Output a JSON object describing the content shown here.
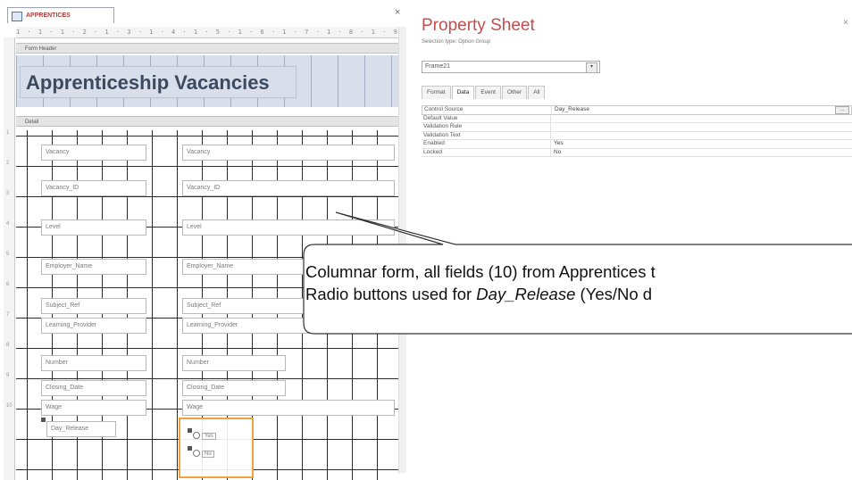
{
  "document_tab": {
    "label": "APPRENTICES"
  },
  "ruler": {
    "ticks": "1 · 1 · 1 · 2 · 1 · 3 · 1 · 4 · 1 · 5 · 1 · 6 · 1 · 7 · 1 · 8 · 1 · 9 · 1 · 10 · 1"
  },
  "sections": {
    "form_header": "Form Header",
    "detail": "Detail"
  },
  "form": {
    "title": "Apprenticeship Vacancies",
    "labels": [
      "Vacancy",
      "Vacancy_ID",
      "Level",
      "Employer_Name",
      "Subject_Ref",
      "Learning_Provider",
      "Number",
      "Closing_Date",
      "Wage",
      "Day_Release"
    ],
    "boxes": [
      "Vacancy",
      "Vacancy_ID",
      "Level",
      "Employer_Name",
      "Subject_Ref",
      "Learning_Provider",
      "Number",
      "Closing_Date",
      "Wage"
    ],
    "option_items": [
      "Yes",
      "No"
    ]
  },
  "property_sheet": {
    "title": "Property Sheet",
    "selection_type": "Selection type: Option Group",
    "selected_control": "Frame21",
    "tabs": [
      "Format",
      "Data",
      "Event",
      "Other",
      "All"
    ],
    "active_tab": "Data",
    "rows": [
      {
        "key": "Control Source",
        "value": "Day_Release"
      },
      {
        "key": "Default Value",
        "value": ""
      },
      {
        "key": "Validation Rule",
        "value": ""
      },
      {
        "key": "Validation Text",
        "value": ""
      },
      {
        "key": "Enabled",
        "value": "Yes"
      },
      {
        "key": "Locked",
        "value": "No"
      }
    ]
  },
  "callout": {
    "line1": "Columnar form, all fields (10) from Apprentices t",
    "line2_prefix": "Radio buttons used for ",
    "line2_field": "Day_Release",
    "line2_suffix": " (Yes/No d"
  },
  "colors": {
    "title_red": "#c0504d",
    "selection_orange": "#f0a33a",
    "header_fill": "#d8deea"
  }
}
